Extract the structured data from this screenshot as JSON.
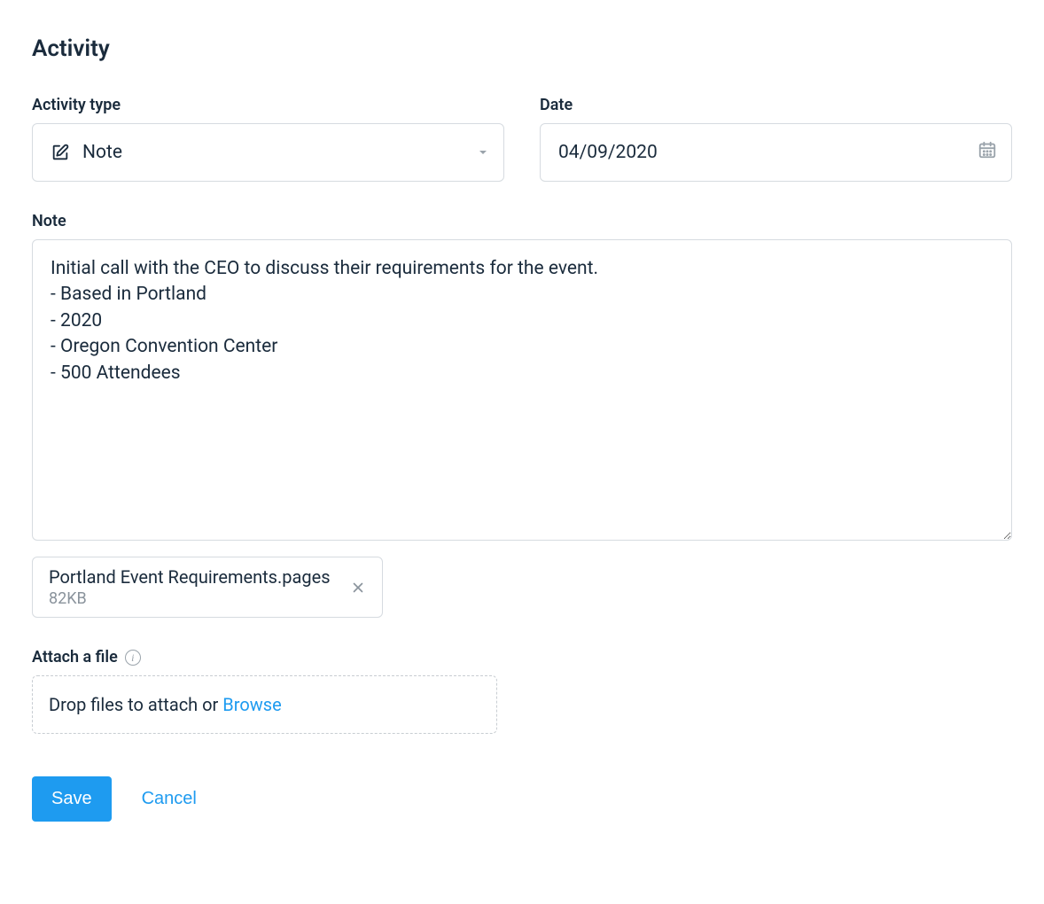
{
  "page": {
    "title": "Activity"
  },
  "activityType": {
    "label": "Activity type",
    "value": "Note",
    "iconName": "edit-note-icon"
  },
  "date": {
    "label": "Date",
    "value": "04/09/2020"
  },
  "note": {
    "label": "Note",
    "value": "Initial call with the CEO to discuss their requirements for the event.\n- Based in Portland\n- 2020\n- Oregon Convention Center\n- 500 Attendees"
  },
  "attachment": {
    "name": "Portland Event Requirements.pages",
    "size": "82KB"
  },
  "attachFile": {
    "label": "Attach a file",
    "dropText": "Drop files to attach or ",
    "browseText": "Browse"
  },
  "actions": {
    "save": "Save",
    "cancel": "Cancel"
  }
}
